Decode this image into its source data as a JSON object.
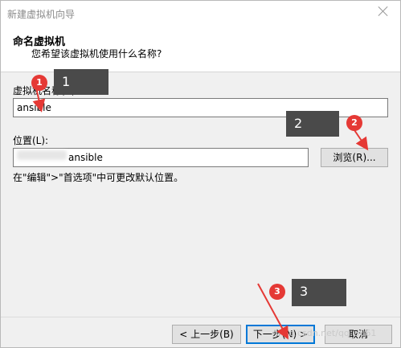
{
  "window": {
    "title": "新建虚拟机向导"
  },
  "header": {
    "title": "命名虚拟机",
    "subtitle": "您希望该虚拟机使用什么名称?"
  },
  "vm_name": {
    "label": "虚拟机名称(V):",
    "value": "ansible"
  },
  "location": {
    "label": "位置(L):",
    "value": "ansible",
    "browse_label": "浏览(R)..."
  },
  "hint": "在\"编辑\">\"首选项\"中可更改默认位置。",
  "footer": {
    "back_label": "< 上一步(B)",
    "next_label": "下一步(N) >",
    "cancel_label": "取消"
  },
  "annotations": [
    {
      "num": "1",
      "box": "1"
    },
    {
      "num": "2",
      "box": "2"
    },
    {
      "num": "3",
      "box": "3"
    }
  ],
  "watermark": "/blog.csdn.net/qq_3061"
}
